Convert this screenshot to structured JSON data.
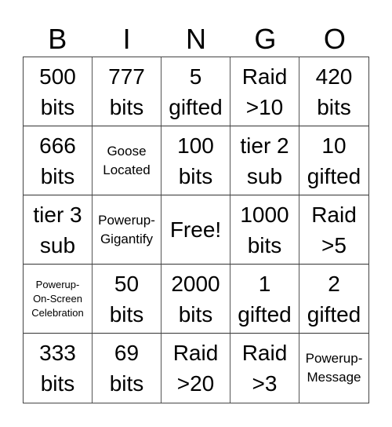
{
  "header": [
    "B",
    "I",
    "N",
    "G",
    "O"
  ],
  "cells": [
    {
      "text": "500\nbits",
      "size": "big"
    },
    {
      "text": "777\nbits",
      "size": "big"
    },
    {
      "text": "5\ngifted",
      "size": "big"
    },
    {
      "text": "Raid\n>10",
      "size": "big"
    },
    {
      "text": "420\nbits",
      "size": "big"
    },
    {
      "text": "666\nbits",
      "size": "big"
    },
    {
      "text": "Goose\nLocated",
      "size": "small"
    },
    {
      "text": "100\nbits",
      "size": "big"
    },
    {
      "text": "tier 2\nsub",
      "size": "big"
    },
    {
      "text": "10\ngifted",
      "size": "big"
    },
    {
      "text": "tier 3\nsub",
      "size": "big"
    },
    {
      "text": "Powerup-\nGigantify",
      "size": "small"
    },
    {
      "text": "Free!",
      "size": "big"
    },
    {
      "text": "1000\nbits",
      "size": "big"
    },
    {
      "text": "Raid\n>5",
      "size": "big"
    },
    {
      "text": "Powerup-\nOn-Screen\nCelebration",
      "size": "tiny"
    },
    {
      "text": "50\nbits",
      "size": "big"
    },
    {
      "text": "2000\nbits",
      "size": "big"
    },
    {
      "text": "1\ngifted",
      "size": "big"
    },
    {
      "text": "2\ngifted",
      "size": "big"
    },
    {
      "text": "333\nbits",
      "size": "big"
    },
    {
      "text": "69\nbits",
      "size": "big"
    },
    {
      "text": "Raid\n>20",
      "size": "big"
    },
    {
      "text": "Raid\n>3",
      "size": "big"
    },
    {
      "text": "Powerup-\nMessage",
      "size": "small"
    }
  ]
}
